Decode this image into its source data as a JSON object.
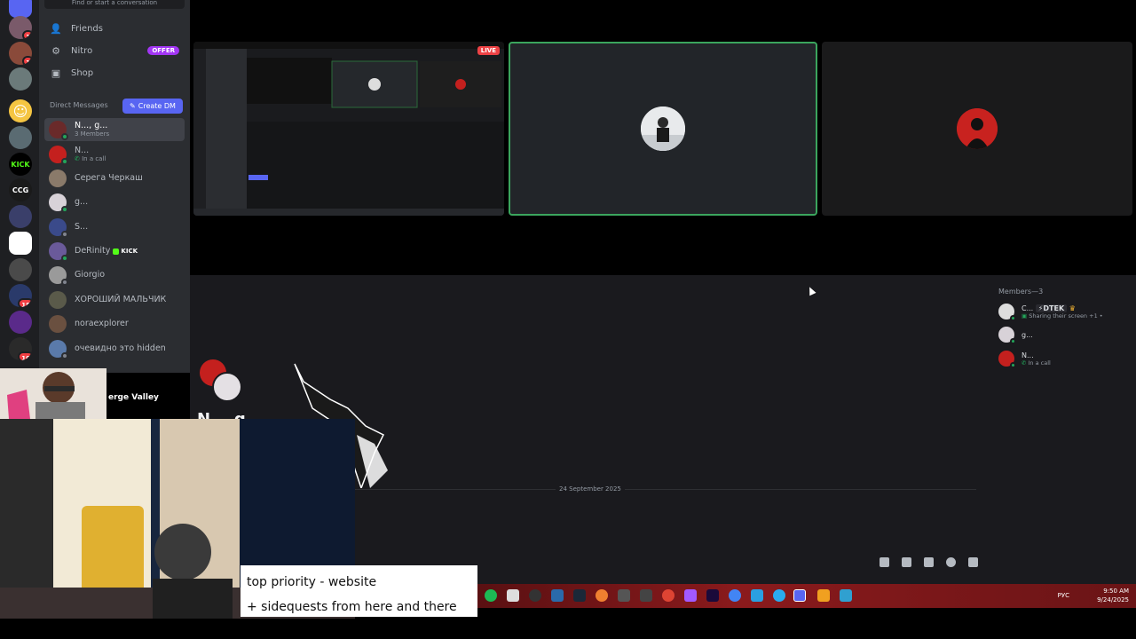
{
  "sidebar": {
    "search_text": "Find or start a conversation",
    "nav": [
      {
        "label": "Friends",
        "icon": "friends-icon"
      },
      {
        "label": "Nitro",
        "icon": "nitro-icon",
        "badge": "OFFER"
      },
      {
        "label": "Shop",
        "icon": "shop-icon"
      }
    ],
    "dm_header": "Direct Messages",
    "create_dm": "Create DM",
    "dms": [
      {
        "name": "N..., g...",
        "sub": "3 Members",
        "active": true
      },
      {
        "name": "N...",
        "sub": "In a call"
      },
      {
        "name": "Серега Черкаш",
        "sub": ""
      },
      {
        "name": "g...",
        "sub": ""
      },
      {
        "name": "S...",
        "sub": ""
      },
      {
        "name": "DeRinity",
        "sub": "",
        "tag": "KICK"
      },
      {
        "name": "Giorgio",
        "sub": ""
      },
      {
        "name": "ХОРОШИЙ МАЛЬЧИК",
        "sub": ""
      },
      {
        "name": "noraexplorer",
        "sub": ""
      },
      {
        "name": "очевидно это hidden",
        "sub": ""
      }
    ]
  },
  "servers": [
    {
      "badge": "1"
    },
    {
      "badge": "1"
    },
    {
      "badge": ""
    },
    {
      "badge": ""
    },
    {
      "label": "KICK",
      "badge": ""
    },
    {
      "label": "CCG",
      "badge": ""
    },
    {
      "badge": ""
    },
    {
      "badge": ""
    },
    {
      "badge": ""
    },
    {
      "badge": "18"
    },
    {
      "badge": ""
    },
    {
      "badge": "10"
    }
  ],
  "stage": {
    "live_label": "LIVE"
  },
  "main": {
    "channel_title": "N... g...",
    "date_divider": "24 September 2025"
  },
  "members": {
    "header": "Members—3",
    "list": [
      {
        "name": "C...",
        "tag": "DTEK",
        "sub": "Sharing their screen +1 •"
      },
      {
        "name": "g...",
        "sub": ""
      },
      {
        "name": "N...",
        "sub": "In a call"
      }
    ]
  },
  "overlay": {
    "voice_channel": "erge Valley",
    "note_line1": "top priority - website",
    "note_line2": "+ sidequests from here and there"
  },
  "taskbar": {
    "lang": "РУС",
    "time": "9:50 AM",
    "date": "9/24/2025"
  },
  "colors": {
    "accent": "#5865f2",
    "online": "#23a55a",
    "live": "#ed4245",
    "speaking_border": "#3ba55d"
  }
}
